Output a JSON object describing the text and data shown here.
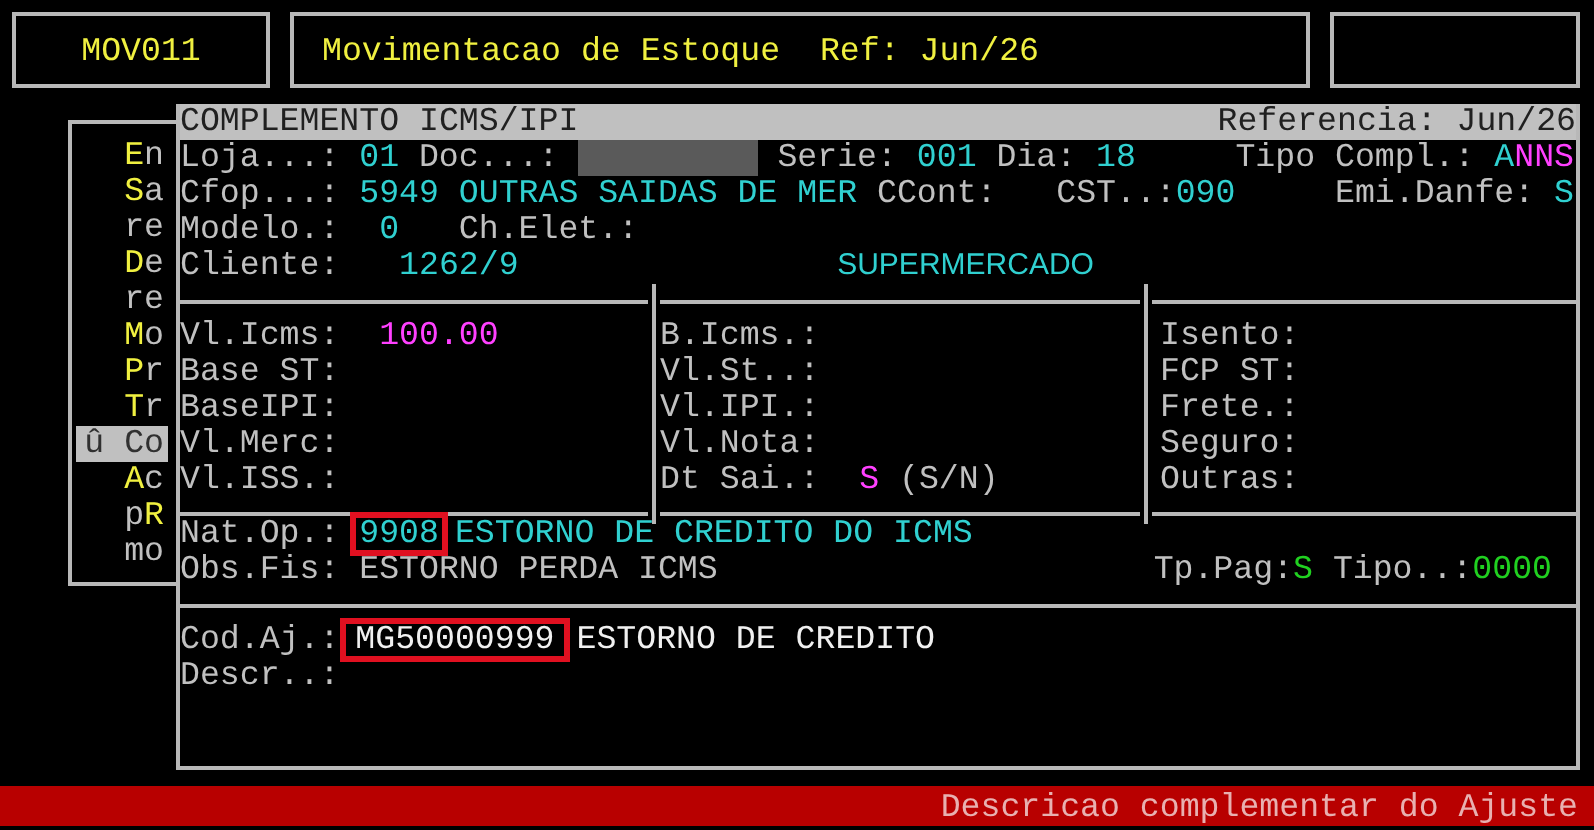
{
  "header": {
    "program_code": "MOV011",
    "title": "Movimentacao de Estoque  Ref: Jun/26"
  },
  "menu": {
    "items": [
      {
        "label": "**E**n",
        "selected": false
      },
      {
        "label": "**S**a",
        "selected": false
      },
      {
        "label": "re",
        "selected": false
      },
      {
        "label": "**D**e",
        "selected": false
      },
      {
        "label": "re",
        "selected": false
      },
      {
        "label": "**M**o",
        "selected": false
      },
      {
        "label": "**P**r",
        "selected": false
      },
      {
        "label": "**T**r",
        "selected": false
      },
      {
        "label": "û Co",
        "selected": true
      },
      {
        "label": "**A**c",
        "selected": false
      },
      {
        "label": "p**R**",
        "selected": false
      },
      {
        "label": "mo",
        "selected": false
      }
    ]
  },
  "dialog": {
    "title": "COMPLEMENTO ICMS/IPI",
    "reference": "Referencia: Jun/26",
    "loja": {
      "label": "Loja...:",
      "value": "01"
    },
    "doc": {
      "label": "Doc...:",
      "redacted": true
    },
    "serie": {
      "label": "Serie:",
      "value": "001"
    },
    "dia": {
      "label": "Dia:",
      "value": "18"
    },
    "tipo_compl": {
      "label": "Tipo Compl.:",
      "value": "A**NNS**"
    },
    "cfop": {
      "label": "Cfop...:",
      "value": "5949 OUTRAS SAIDAS DE MER"
    },
    "ccont": {
      "label": "CCont:"
    },
    "cst": {
      "label": "CST..:",
      "value": "090"
    },
    "emi_danfe": {
      "label": "Emi.Danfe:",
      "value": "S"
    },
    "modelo": {
      "label": "Modelo.:",
      "value": "0"
    },
    "ch_elet": {
      "label": "Ch.Elet.:"
    },
    "cliente": {
      "label": "Cliente:",
      "value": "1262/9",
      "name": "SUPERMERCADO"
    },
    "columns": [
      [
        {
          "label": "Vl.Icms:",
          "value": "100.00"
        },
        {
          "label": "Base ST:"
        },
        {
          "label": "BaseIPI:"
        },
        {
          "label": "Vl.Merc:"
        },
        {
          "label": "Vl.ISS.:"
        }
      ],
      [
        {
          "label": "B.Icms.:"
        },
        {
          "label": "Vl.St..:"
        },
        {
          "label": "Vl.IPI.:"
        },
        {
          "label": "Vl.Nota:"
        },
        {
          "label": "Dt Sai.:",
          "value": "S",
          "hint": "(S/N)"
        }
      ],
      [
        {
          "label": "Isento:"
        },
        {
          "label": "FCP ST:"
        },
        {
          "label": "Frete.:"
        },
        {
          "label": "Seguro:"
        },
        {
          "label": "Outras:"
        }
      ]
    ],
    "nat_op": {
      "label": "Nat.Op.:",
      "value": "9908",
      "highlighted": true,
      "description": "ESTORNO DE CREDITO DO ICMS"
    },
    "obs_fis": {
      "label": "Obs.Fis:",
      "value": "ESTORNO PERDA ICMS"
    },
    "tp_pag": {
      "label": "Tp.Pag:",
      "value": "S"
    },
    "tipo": {
      "label": "Tipo..:",
      "value": "0000"
    },
    "cod_aj": {
      "label": "Cod.Aj.:",
      "value": "MG50000999",
      "highlighted": true,
      "description": "ESTORNO DE CREDITO"
    },
    "descr": {
      "label": "Descr..:"
    }
  },
  "status_bar": {
    "message": "Descricao complementar do Ajuste"
  }
}
